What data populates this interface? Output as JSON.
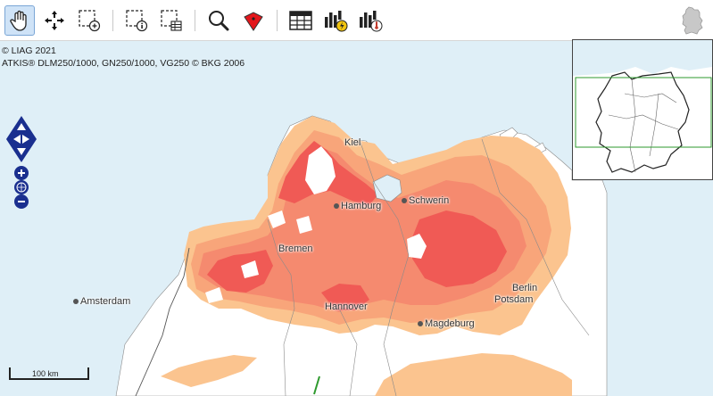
{
  "toolbar": {
    "tools": [
      {
        "name": "pan-hand-icon",
        "active": true
      },
      {
        "name": "full-extent-icon"
      },
      {
        "name": "zoom-box-icon"
      },
      {
        "name": "identify-box-icon"
      },
      {
        "name": "select-table-box-icon"
      },
      {
        "name": "search-icon"
      },
      {
        "name": "marker-icon"
      },
      {
        "name": "table-icon"
      },
      {
        "name": "chart-energy-icon"
      },
      {
        "name": "chart-temperature-icon"
      }
    ],
    "right_icon": "germany-map-icon"
  },
  "attribution": {
    "line1": "© LIAG 2021",
    "line2": "ATKIS® DLM250/1000, GN250/1000, VG250 © BKG 2006"
  },
  "cities": {
    "kiel": "Kiel",
    "hamburg": "Hamburg",
    "schwerin": "Schwerin",
    "bremen": "Bremen",
    "amsterdam": "Amsterdam",
    "hannover": "Hannover",
    "berlin": "Berlin",
    "potsdam": "Potsdam",
    "magdeburg": "Magdeburg"
  },
  "scale": {
    "label": "100 km"
  },
  "colors": {
    "sea": "#dfeff7",
    "land": "#ffffff",
    "light_orange": "#fbc48f",
    "orange": "#f8a57a",
    "salmon": "#f58a6f",
    "red": "#f05a55",
    "nav_blue": "#1a2f8f",
    "overview_box": "#2e9a2e"
  }
}
